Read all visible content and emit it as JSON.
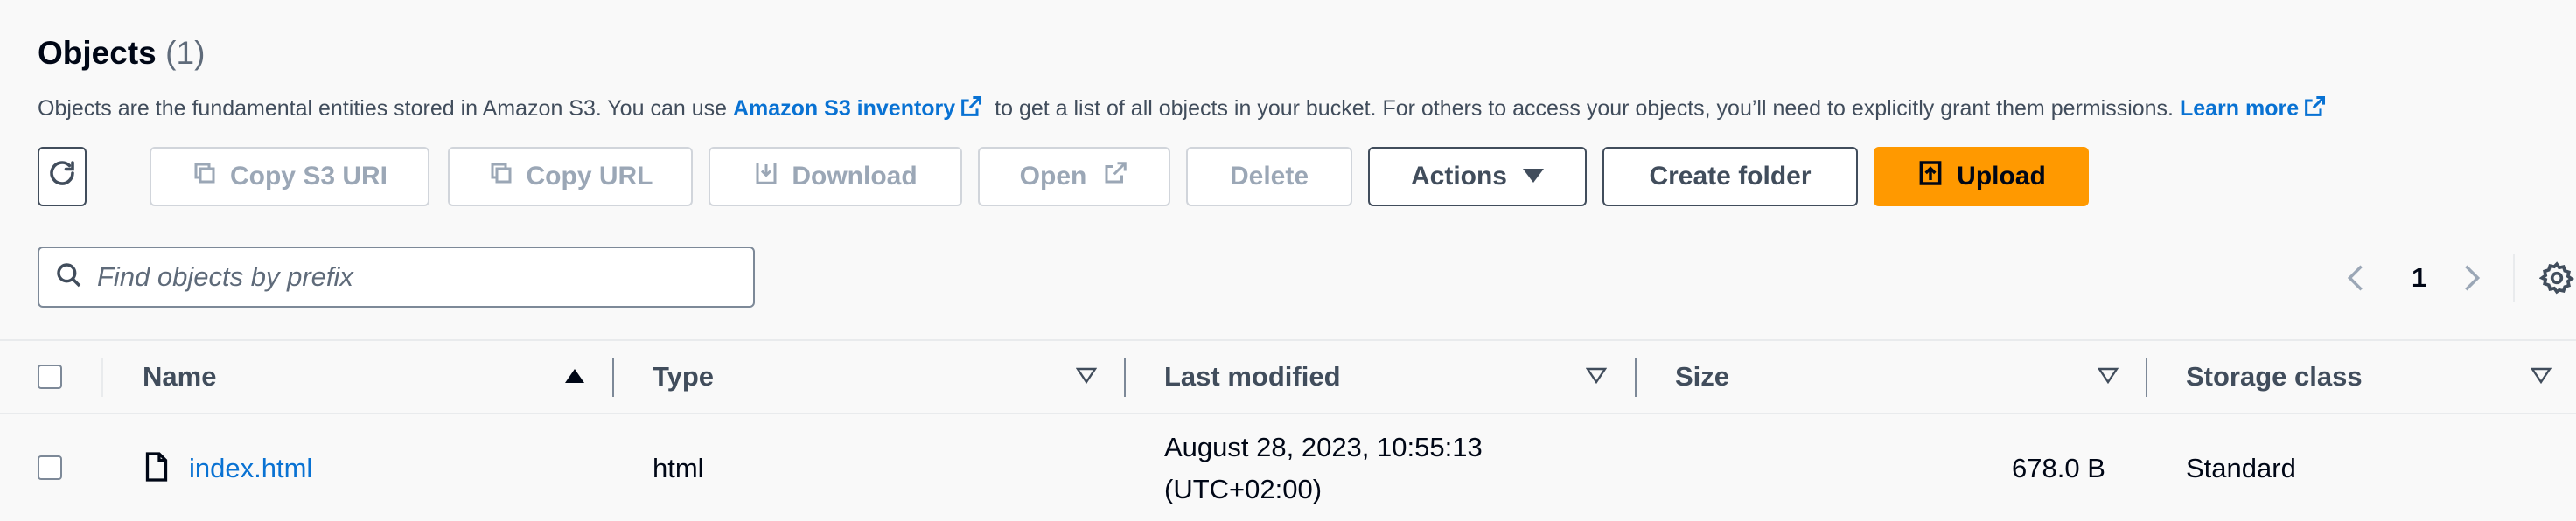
{
  "header": {
    "title": "Objects",
    "count": "(1)"
  },
  "description": {
    "part1": "Objects are the fundamental entities stored in Amazon S3. You can use",
    "link1": "Amazon S3 inventory",
    "part2": "to get a list of all objects in your bucket. For others to access your objects, you’ll need to explicitly grant them permissions.",
    "link2": "Learn more"
  },
  "toolbar": {
    "refresh_icon": "refresh-icon",
    "copy_s3_uri": "Copy S3 URI",
    "copy_url": "Copy URL",
    "download": "Download",
    "open": "Open",
    "delete": "Delete",
    "actions": "Actions",
    "create_folder": "Create folder",
    "upload": "Upload"
  },
  "search": {
    "placeholder": "Find objects by prefix",
    "value": ""
  },
  "pagination": {
    "current_page": "1"
  },
  "table": {
    "columns": [
      "Name",
      "Type",
      "Last modified",
      "Size",
      "Storage class"
    ],
    "rows": [
      {
        "name": "index.html",
        "type": "html",
        "last_modified_line1": "August 28, 2023, 10:55:13",
        "last_modified_line2": "(UTC+02:00)",
        "size": "678.0 B",
        "storage_class": "Standard"
      }
    ]
  },
  "colors": {
    "link": "#0972d3",
    "primary": "#ff9900",
    "text": "#000716",
    "disabled": "#9ba7b6",
    "background": "#f9f9f9"
  }
}
